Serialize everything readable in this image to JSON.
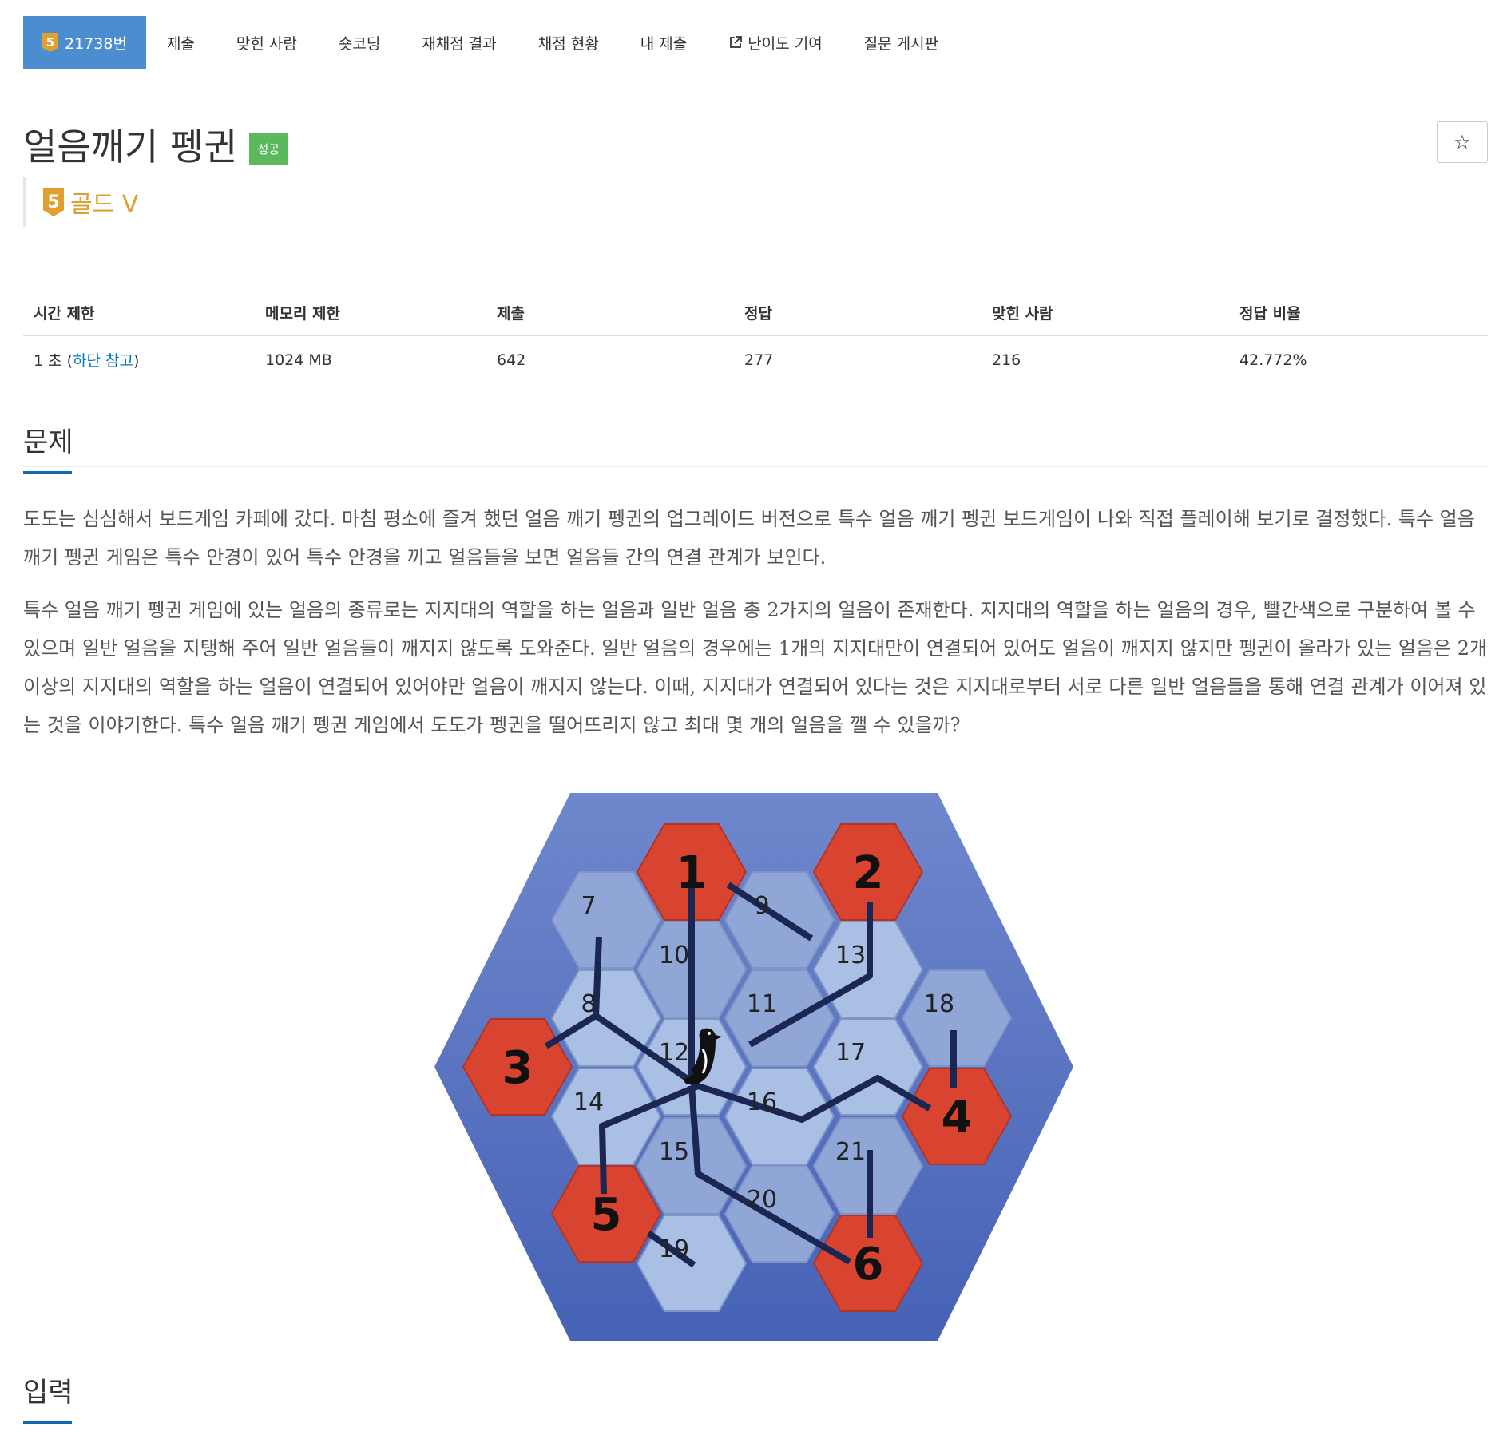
{
  "nav": {
    "tier_badge": "5",
    "problem_number": "21738번",
    "items": [
      "제출",
      "맞힌 사람",
      "숏코딩",
      "재채점 결과",
      "채점 현황",
      "내 제출",
      "난이도 기여",
      "질문 게시판"
    ]
  },
  "title": "얼음깨기 펭귄",
  "success_badge": "성공",
  "star": "☆",
  "tier": {
    "badge": "5",
    "name": "골드 V"
  },
  "stats": {
    "headers": [
      "시간 제한",
      "메모리 제한",
      "제출",
      "정답",
      "맞힌 사람",
      "정답 비율"
    ],
    "time_prefix": "1 초 (",
    "time_link": "하단 참고",
    "time_suffix": ")",
    "memory": "1024 MB",
    "submissions": "642",
    "accepted": "277",
    "solvers": "216",
    "ratio": "42.772%"
  },
  "problem": {
    "heading": "문제",
    "para1": "도도는 심심해서 보드게임 카페에 갔다. 마침 평소에 즐겨 했던 얼음 깨기 펭귄의 업그레이드 버전으로 특수 얼음 깨기 펭귄 보드게임이 나와 직접 플레이해 보기로 결정했다. 특수 얼음 깨기 펭귄 게임은 특수 안경이 있어 특수 안경을 끼고 얼음들을 보면 얼음들 간의 연결 관계가 보인다.",
    "para2": "특수 얼음 깨기 펭귄 게임에 있는 얼음의 종류로는 지지대의 역할을 하는 얼음과 일반 얼음 총 2가지의 얼음이 존재한다. 지지대의 역할을 하는 얼음의 경우, 빨간색으로 구분하여 볼 수 있으며 일반 얼음을 지탱해 주어 일반 얼음들이 깨지지 않도록 도와준다. 일반 얼음의 경우에는 1개의 지지대만이 연결되어 있어도 얼음이 깨지지 않지만 펭귄이 올라가 있는 얼음은 2개 이상의 지지대의 역할을 하는 얼음이 연결되어 있어야만 얼음이 깨지지 않는다. 이때, 지지대가 연결되어 있다는 것은 지지대로부터 서로 다른 일반 얼음들을 통해 연결 관계가 이어져 있는 것을 이야기한다. 특수 얼음 깨기 펭귄 게임에서 도도가 펭귄을 떨어뜨리지 않고 최대 몇 개의 얼음을 깰 수 있을까?"
  },
  "figure": {
    "support_color": "#d94430",
    "ice_light": "#a9c0e4",
    "ice_mid": "#8fa6d6",
    "board_color": "#4f6cc0",
    "line_color": "#1c2652",
    "supports": [
      "1",
      "2",
      "3",
      "4",
      "5",
      "6"
    ],
    "ice": [
      "7",
      "8",
      "9",
      "10",
      "11",
      "12",
      "13",
      "14",
      "15",
      "16",
      "17",
      "18",
      "19",
      "20",
      "21"
    ]
  },
  "input": {
    "heading": "입력"
  }
}
